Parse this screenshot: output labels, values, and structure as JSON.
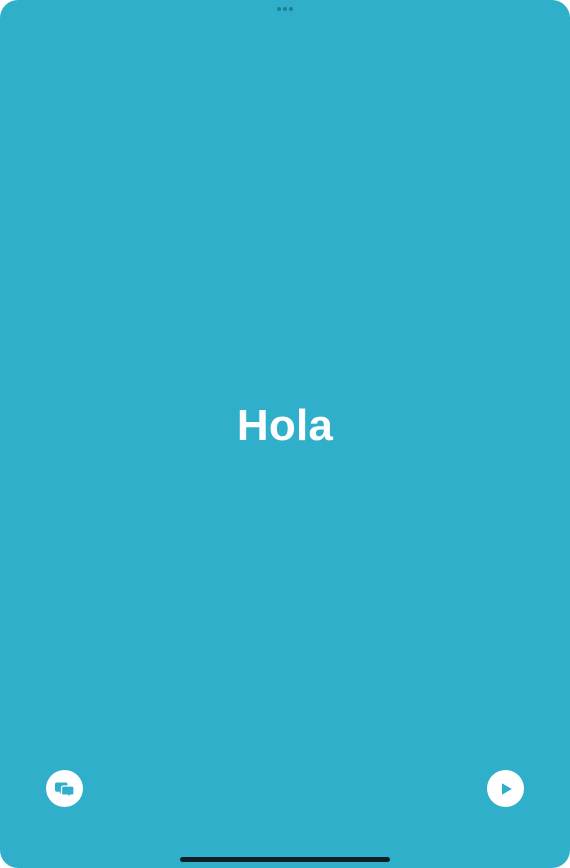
{
  "main": {
    "phrase": "Hola"
  },
  "controls": {
    "left_icon": "speech-bubbles-icon",
    "right_icon": "play-icon"
  },
  "colors": {
    "background": "#2fafc9",
    "accent": "#2fafc9",
    "text": "#ffffff",
    "dots": "#1e7f95",
    "home_indicator": "#0d1f26"
  }
}
